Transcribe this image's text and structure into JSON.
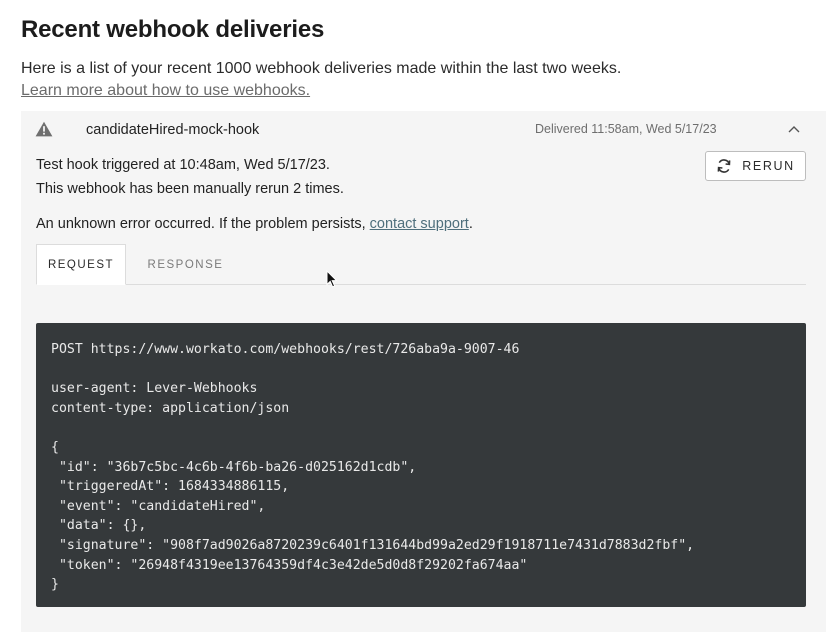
{
  "page": {
    "title": "Recent webhook deliveries",
    "intro": "Here is a list of your recent 1000 webhook deliveries made within the last two weeks.",
    "learn_link": "Learn more about how to use webhooks."
  },
  "delivery": {
    "hook_name": "candidateHired-mock-hook",
    "status": "Delivered 11:58am, Wed 5/17/23",
    "trigger_text": "Test hook triggered at 10:48am, Wed 5/17/23.",
    "rerun_text": "This webhook has been manually rerun 2 times.",
    "error_prefix": "An unknown error occurred. If the problem persists, ",
    "contact_link": "contact support",
    "error_suffix": ".",
    "rerun_button": "RERUN",
    "icons": {
      "status": "warning-icon",
      "collapse": "chevron-up-icon",
      "rerun": "refresh-icon"
    }
  },
  "tabs": [
    {
      "label": "REQUEST",
      "active": true
    },
    {
      "label": "RESPONSE",
      "active": false
    }
  ],
  "request_code": [
    "POST https://www.workato.com/webhooks/rest/726aba9a-9007-46",
    "",
    "user-agent: Lever-Webhooks",
    "content-type: application/json",
    "",
    "{",
    " \"id\": \"36b7c5bc-4c6b-4f6b-ba26-d025162d1cdb\",",
    " \"triggeredAt\": 1684334886115,",
    " \"event\": \"candidateHired\",",
    " \"data\": {},",
    " \"signature\": \"908f7ad9026a8720239c6401f131644bd99a2ed29f1918711e7431d7883d2fbf\",",
    " \"token\": \"26948f4319ee13764359df4c3e42de5d0d8f29202fa674aa\"",
    "}"
  ]
}
